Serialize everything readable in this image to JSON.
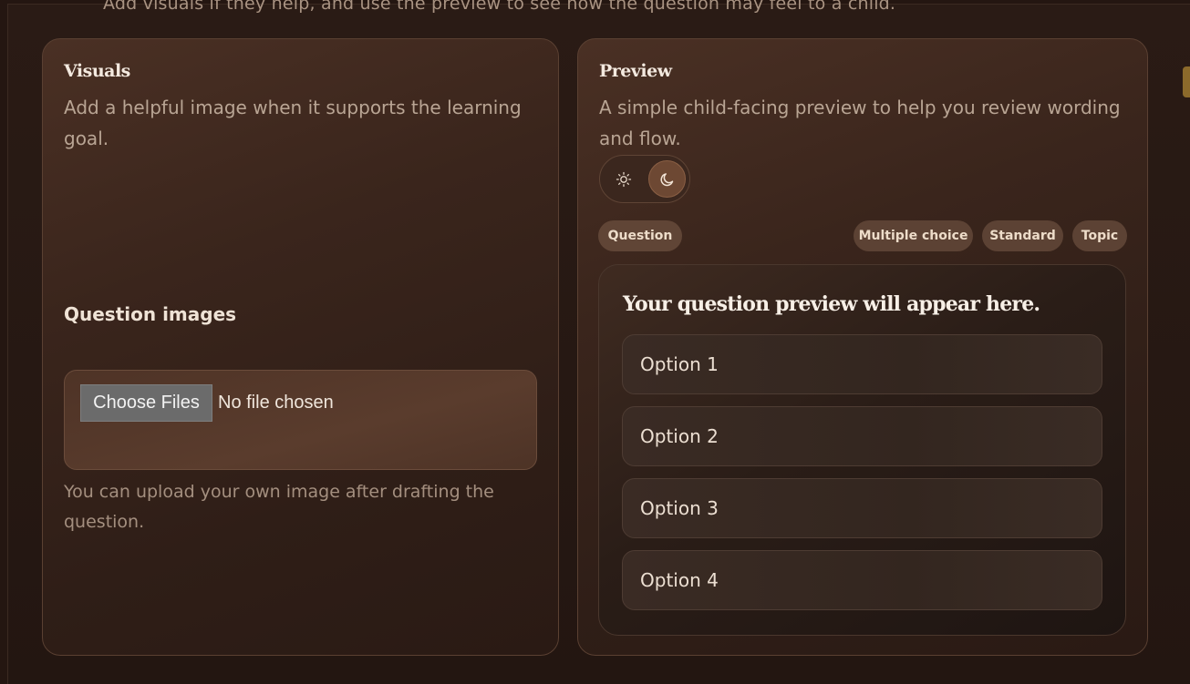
{
  "intro_text": "Add visuals if they help, and use the preview to see how the question may feel to a child.",
  "visuals": {
    "title": "Visuals",
    "description": "Add a helpful image when it supports the learning goal.",
    "section_label": "Question images",
    "file_button": "Choose Files",
    "file_status": "No file chosen",
    "help_text": "You can upload your own image after drafting the question."
  },
  "preview": {
    "title": "Preview",
    "description": "A simple child-facing preview to help you review wording and flow.",
    "theme_toggle": {
      "light_icon": "sun-icon",
      "dark_icon": "moon-icon",
      "selected": "dark"
    },
    "tag_question": "Question",
    "tags": [
      "Multiple choice",
      "Standard",
      "Topic"
    ],
    "question_text": "Your question preview will appear here.",
    "options": [
      "Option 1",
      "Option 2",
      "Option 3",
      "Option 4"
    ]
  },
  "colors": {
    "background": "#241611",
    "panel": "#3a251c",
    "accent": "#6d4833"
  }
}
